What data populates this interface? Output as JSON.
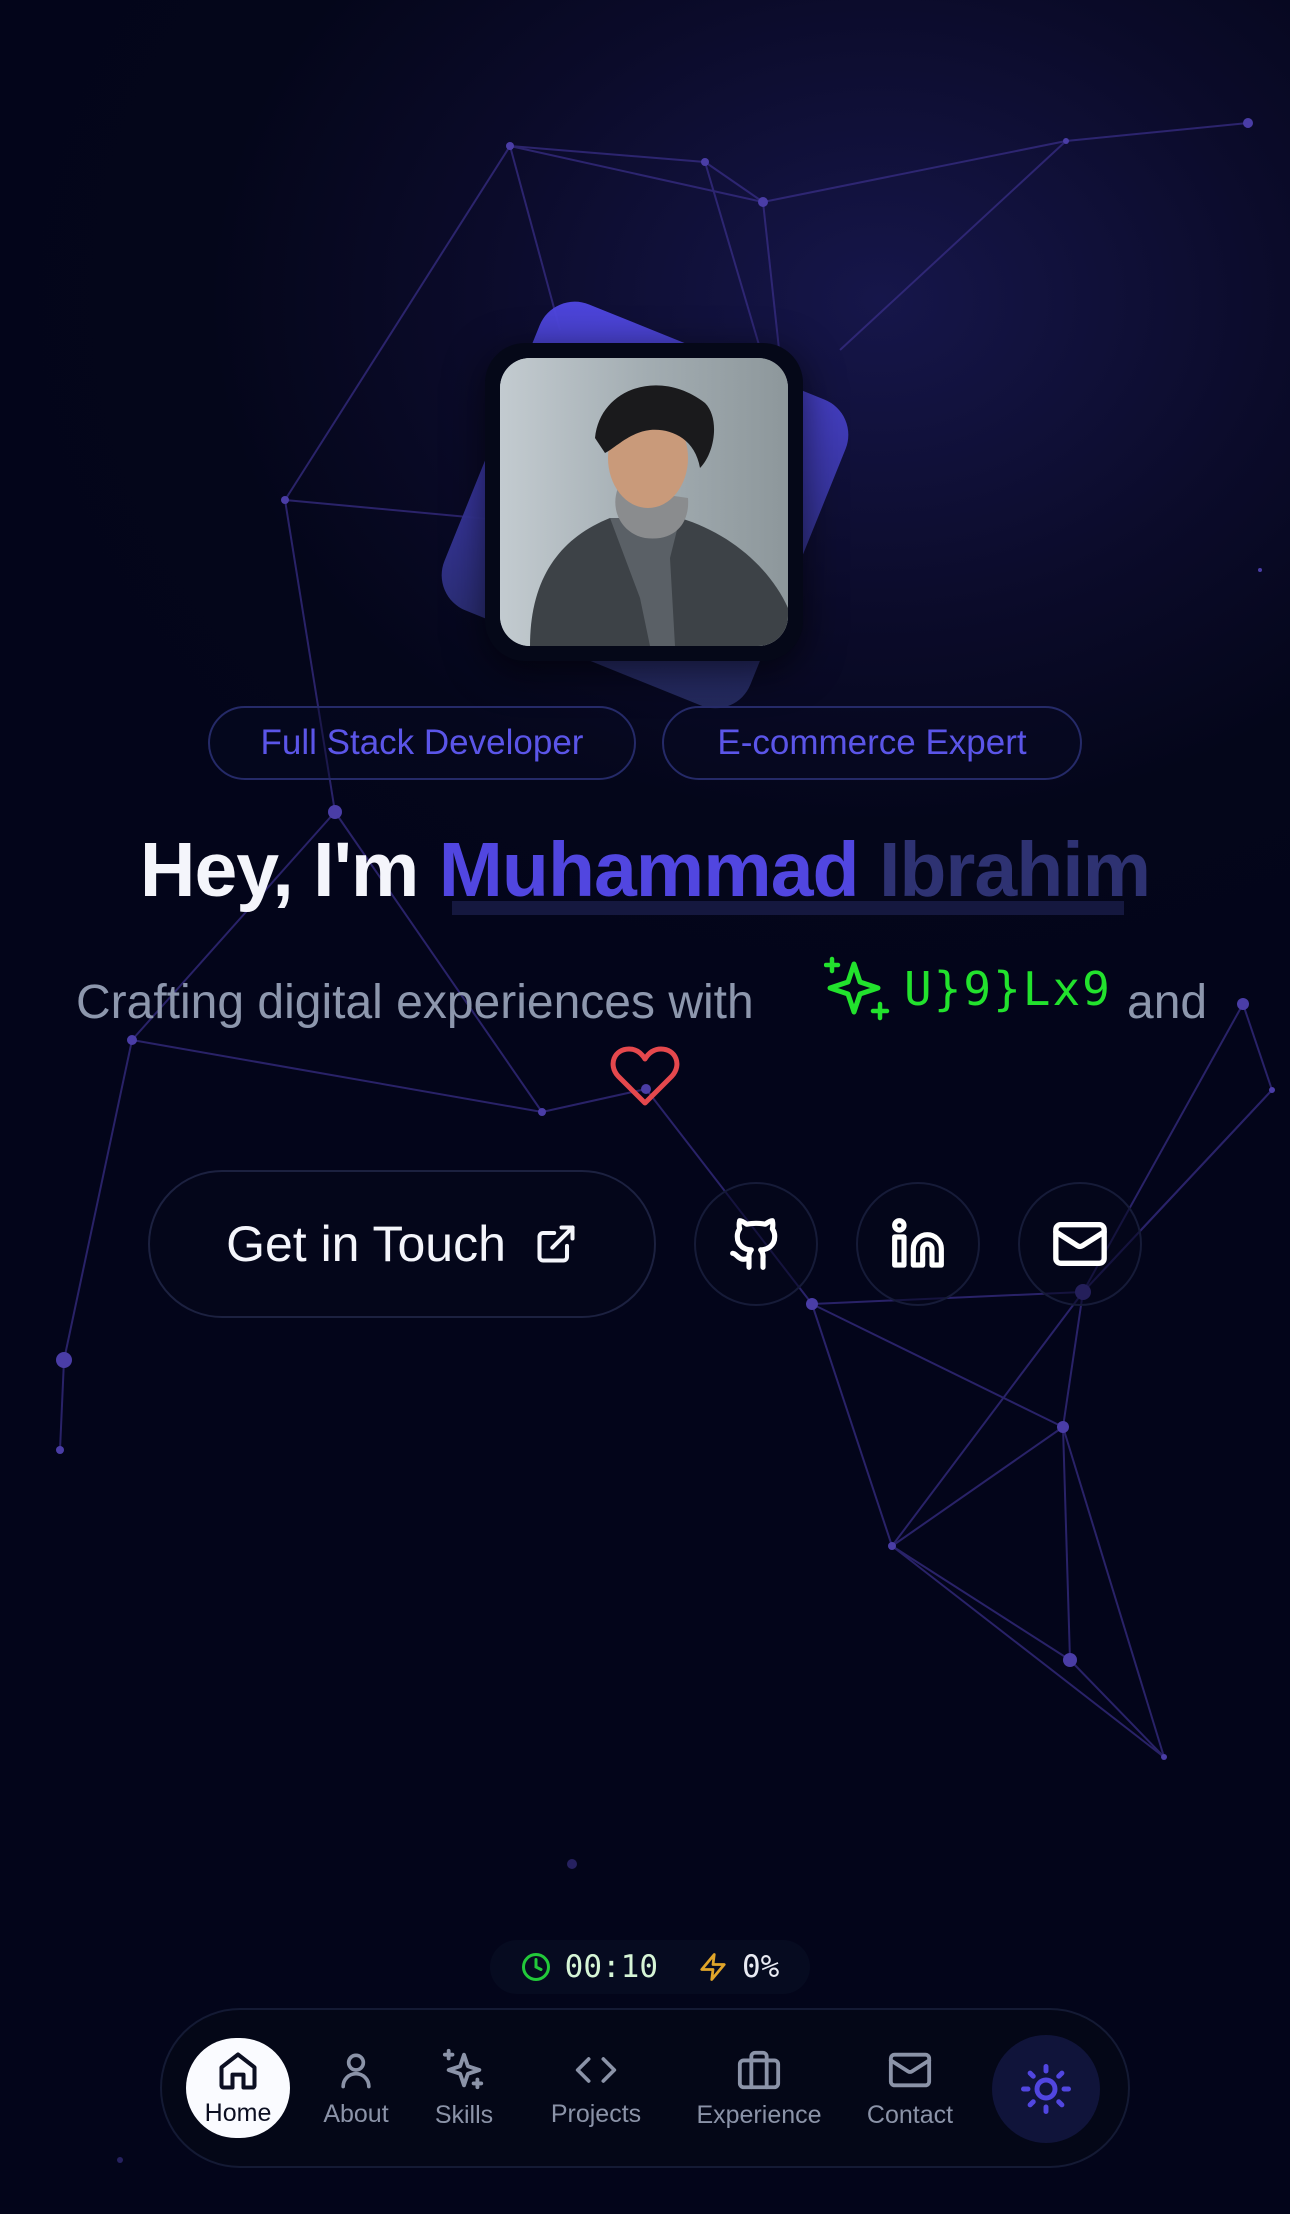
{
  "hero": {
    "tags": [
      "Full Stack Developer",
      "E-commerce Expert"
    ],
    "greeting": "Hey, I'm",
    "name_first": "Muhammad",
    "name_last": "Ibrahim",
    "tagline_prefix": "Crafting digital experiences with",
    "scramble_text": "U}9}Lx9",
    "tagline_suffix": "and",
    "cta_label": "Get in Touch"
  },
  "social": [
    {
      "name": "github-icon"
    },
    {
      "name": "linkedin-icon"
    },
    {
      "name": "mail-icon"
    }
  ],
  "status": {
    "timer": "00:10",
    "progress": "0%"
  },
  "nav": {
    "items": [
      {
        "label": "Home",
        "icon": "home-icon",
        "active": true
      },
      {
        "label": "About",
        "icon": "user-icon"
      },
      {
        "label": "Skills",
        "icon": "sparkles-icon"
      },
      {
        "label": "Projects",
        "icon": "code-icon"
      },
      {
        "label": "Experience",
        "icon": "briefcase-icon"
      },
      {
        "label": "Contact",
        "icon": "mail-icon"
      }
    ],
    "theme_toggle_icon": "sun-icon"
  },
  "colors": {
    "accent": "#5146e0",
    "code_green": "#22e22d",
    "heart_red": "#e5484d",
    "lightning_amber": "#e0a52a"
  }
}
